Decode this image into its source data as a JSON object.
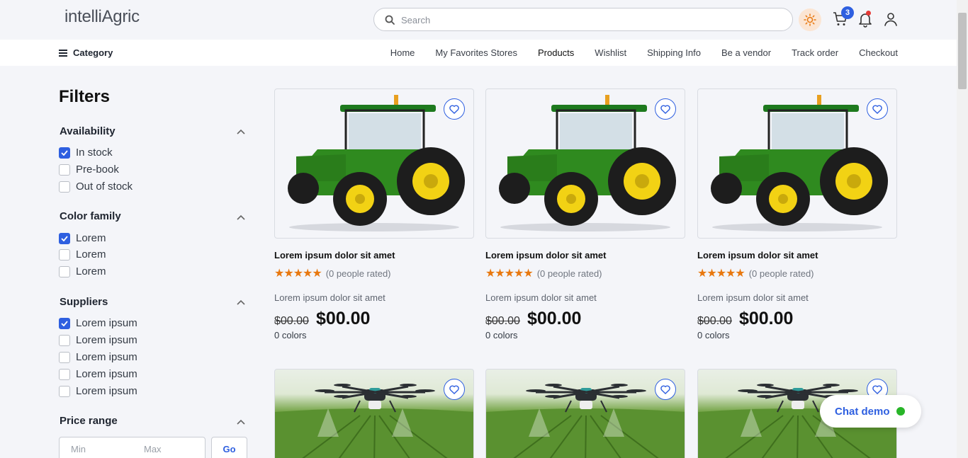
{
  "header": {
    "logo": "intelliAgric",
    "search_placeholder": "Search",
    "cart_count": "3"
  },
  "nav": {
    "category_label": "Category",
    "links": [
      "Home",
      "My Favorites Stores",
      "Products",
      "Wishlist",
      "Shipping Info",
      "Be a vendor",
      "Track order",
      "Checkout"
    ],
    "active": "Products"
  },
  "filters": {
    "title": "Filters",
    "availability": {
      "title": "Availability",
      "options": [
        {
          "label": "In stock",
          "checked": true
        },
        {
          "label": "Pre-book",
          "checked": false
        },
        {
          "label": "Out of stock",
          "checked": false
        }
      ]
    },
    "color_family": {
      "title": "Color family",
      "options": [
        {
          "label": "Lorem",
          "checked": true
        },
        {
          "label": "Lorem",
          "checked": false
        },
        {
          "label": "Lorem",
          "checked": false
        }
      ]
    },
    "suppliers": {
      "title": "Suppliers",
      "options": [
        {
          "label": "Lorem ipsum",
          "checked": true
        },
        {
          "label": "Lorem ipsum",
          "checked": false
        },
        {
          "label": "Lorem ipsum",
          "checked": false
        },
        {
          "label": "Lorem ipsum",
          "checked": false
        },
        {
          "label": "Lorem ipsum",
          "checked": false
        }
      ]
    },
    "price_range": {
      "title": "Price range",
      "min_placeholder": "Min",
      "max_placeholder": "Max",
      "go_label": "Go"
    }
  },
  "products": [
    {
      "title": "Lorem ipsum dolor sit amet",
      "rating_text": "(0 people rated)",
      "desc": "Lorem ipsum dolor sit amet",
      "old_price": "$00.00",
      "price": "$00.00",
      "colors": "0 colors",
      "image": "tractor"
    },
    {
      "title": "Lorem ipsum dolor sit amet",
      "rating_text": "(0 people rated)",
      "desc": "Lorem ipsum dolor sit amet",
      "old_price": "$00.00",
      "price": "$00.00",
      "colors": "0 colors",
      "image": "tractor"
    },
    {
      "title": "Lorem ipsum dolor sit amet",
      "rating_text": "(0 people rated)",
      "desc": "Lorem ipsum dolor sit amet",
      "old_price": "$00.00",
      "price": "$00.00",
      "colors": "0 colors",
      "image": "tractor"
    },
    {
      "image": "drone"
    },
    {
      "image": "drone"
    },
    {
      "image": "drone"
    }
  ],
  "chat": {
    "label": "Chat demo"
  },
  "colors": {
    "accent": "#2e5fe0",
    "star": "#e8780f",
    "online": "#28b528"
  }
}
